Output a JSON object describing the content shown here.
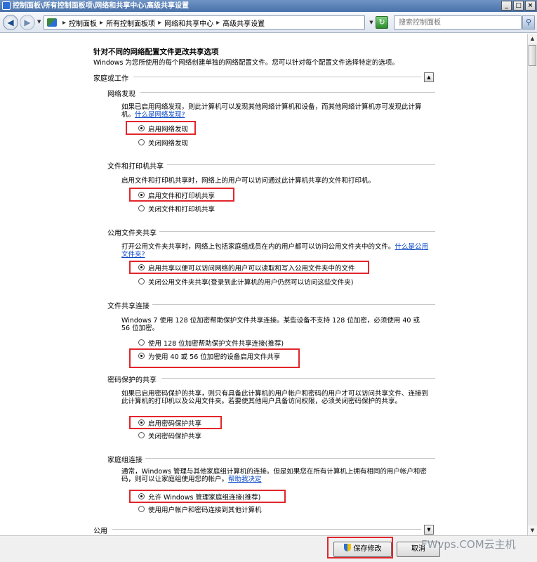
{
  "window": {
    "title": "控制面板\\所有控制面板项\\网络和共享中心\\高级共享设置"
  },
  "address": {
    "crumbs": [
      "控制面板",
      "所有控制面板项",
      "网络和共享中心",
      "高级共享设置"
    ],
    "search_placeholder": "搜索控制面板"
  },
  "page": {
    "title": "针对不同的网络配置文件更改共享选项",
    "description": "Windows 为您所使用的每个网络创建单独的网络配置文件。您可以针对每个配置文件选择特定的选项。"
  },
  "profiles": {
    "home": {
      "label": "家庭或工作"
    },
    "public": {
      "label": "公用"
    }
  },
  "sections": {
    "discovery": {
      "title": "网络发现",
      "desc": "如果已启用网络发现，则此计算机可以发现其他网络计算机和设备，而其他网络计算机亦可发现此计算机。",
      "link": "什么是网络发现?",
      "on": "启用网络发现",
      "off": "关闭网络发现"
    },
    "fileprint": {
      "title": "文件和打印机共享",
      "desc": "启用文件和打印机共享时，网络上的用户可以访问通过此计算机共享的文件和打印机。",
      "on": "启用文件和打印机共享",
      "off": "关闭文件和打印机共享"
    },
    "publicfolder": {
      "title": "公用文件夹共享",
      "desc": "打开公用文件夹共享时，网络上包括家庭组成员在内的用户都可以访问公用文件夹中的文件。",
      "link": "什么是公用文件夹?",
      "on": "启用共享以便可以访问网络的用户可以读取和写入公用文件夹中的文件",
      "off": "关闭公用文件夹共享(登录到此计算机的用户仍然可以访问这些文件夹)"
    },
    "connection": {
      "title": "文件共享连接",
      "desc": "Windows 7 使用 128 位加密帮助保护文件共享连接。某些设备不支持 128 位加密，必须使用 40 或 56 位加密。",
      "opt128": "使用 128 位加密帮助保护文件共享连接(推荐)",
      "opt40": "为使用 40 或 56 位加密的设备启用文件共享"
    },
    "password": {
      "title": "密码保护的共享",
      "desc": "如果已启用密码保护的共享，则只有具备此计算机的用户帐户和密码的用户才可以访问共享文件、连接到此计算机的打印机以及公用文件夹。若要使其他用户具备访问权限，必须关闭密码保护的共享。",
      "on": "启用密码保护共享",
      "off": "关闭密码保护共享"
    },
    "homegroup": {
      "title": "家庭组连接",
      "desc": "通常，Windows 管理与其他家庭组计算机的连接。但是如果您在所有计算机上拥有相同的用户帐户和密码，则可以让家庭组使用您的帐户。",
      "link": "帮助我决定",
      "allow": "允许 Windows 管理家庭组连接(推荐)",
      "user": "使用用户帐户和密码连接到其他计算机"
    }
  },
  "buttons": {
    "save": "保存修改",
    "cancel": "取消"
  },
  "watermark": "FWvps.COM云主机",
  "colors": {
    "highlight": "#e2262b",
    "link": "#0645c4",
    "titlebar": "#4a72aa"
  }
}
